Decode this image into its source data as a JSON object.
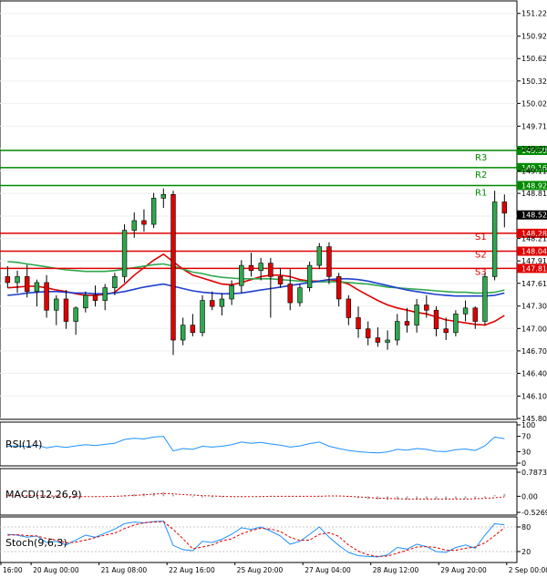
{
  "chart_data": {
    "type": "candlestick",
    "main": {
      "y_ticks": [
        "151.225",
        "150.920",
        "150.620",
        "150.320",
        "150.020",
        "149.715",
        "149.415",
        "149.115",
        "148.815",
        "148.510",
        "148.210",
        "147.910",
        "147.610",
        "147.305",
        "147.005",
        "146.705",
        "146.405",
        "146.100",
        "145.800"
      ],
      "ylim": [
        145.8,
        151.38
      ],
      "current_price": 148.526,
      "current_price_label": "148.526",
      "resistance": [
        {
          "name": "R3",
          "value": 149.39,
          "label": "149.390"
        },
        {
          "name": "R2",
          "value": 149.16,
          "label": "149.160"
        },
        {
          "name": "R1",
          "value": 148.92,
          "label": "148.920"
        }
      ],
      "support": [
        {
          "name": "S1",
          "value": 148.28,
          "label": "148.280"
        },
        {
          "name": "S2",
          "value": 148.04,
          "label": "148.040"
        },
        {
          "name": "S3",
          "value": 147.81,
          "label": "147.810"
        }
      ],
      "candles": [
        [
          147.7,
          147.84,
          147.55,
          147.62
        ],
        [
          147.62,
          147.78,
          147.48,
          147.7
        ],
        [
          147.7,
          147.86,
          147.42,
          147.5
        ],
        [
          147.5,
          147.66,
          147.3,
          147.62
        ],
        [
          147.62,
          147.72,
          147.15,
          147.25
        ],
        [
          147.25,
          147.45,
          147.05,
          147.4
        ],
        [
          147.4,
          147.52,
          147.0,
          147.1
        ],
        [
          147.1,
          147.3,
          146.92,
          147.28
        ],
        [
          147.28,
          147.5,
          147.22,
          147.45
        ],
        [
          147.45,
          147.58,
          147.3,
          147.38
        ],
        [
          147.38,
          147.6,
          147.25,
          147.55
        ],
        [
          147.55,
          147.75,
          147.45,
          147.7
        ],
        [
          147.7,
          148.4,
          147.62,
          148.32
        ],
        [
          148.32,
          148.56,
          148.22,
          148.45
        ],
        [
          148.45,
          148.6,
          148.3,
          148.4
        ],
        [
          148.4,
          148.82,
          148.35,
          148.75
        ],
        [
          148.75,
          148.88,
          148.62,
          148.8
        ],
        [
          148.8,
          148.85,
          146.65,
          146.85
        ],
        [
          146.85,
          147.15,
          146.78,
          147.05
        ],
        [
          147.05,
          147.2,
          146.9,
          146.95
        ],
        [
          146.95,
          147.45,
          146.9,
          147.38
        ],
        [
          147.38,
          147.5,
          147.25,
          147.3
        ],
        [
          147.3,
          147.48,
          147.18,
          147.4
        ],
        [
          147.4,
          147.65,
          147.32,
          147.58
        ],
        [
          147.58,
          147.92,
          147.48,
          147.85
        ],
        [
          147.85,
          148.02,
          147.7,
          147.78
        ],
        [
          147.78,
          147.95,
          147.65,
          147.88
        ],
        [
          147.88,
          147.95,
          147.15,
          147.7
        ],
        [
          147.7,
          147.82,
          147.55,
          147.6
        ],
        [
          147.6,
          147.8,
          147.25,
          147.35
        ],
        [
          147.35,
          147.6,
          147.3,
          147.55
        ],
        [
          147.55,
          147.9,
          147.5,
          147.85
        ],
        [
          147.85,
          148.15,
          147.8,
          148.1
        ],
        [
          148.1,
          148.16,
          147.6,
          147.7
        ],
        [
          147.7,
          147.75,
          147.3,
          147.4
        ],
        [
          147.4,
          147.45,
          147.05,
          147.15
        ],
        [
          147.15,
          147.3,
          146.88,
          147.0
        ],
        [
          147.0,
          147.1,
          146.78,
          146.88
        ],
        [
          146.88,
          147.02,
          146.76,
          146.82
        ],
        [
          146.82,
          146.98,
          146.72,
          146.85
        ],
        [
          146.85,
          147.2,
          146.78,
          147.1
        ],
        [
          147.1,
          147.28,
          146.95,
          147.05
        ],
        [
          147.05,
          147.4,
          146.95,
          147.32
        ],
        [
          147.32,
          147.45,
          147.15,
          147.25
        ],
        [
          147.25,
          147.3,
          146.9,
          147.0
        ],
        [
          147.0,
          147.15,
          146.85,
          146.95
        ],
        [
          146.95,
          147.25,
          146.9,
          147.2
        ],
        [
          147.2,
          147.38,
          147.1,
          147.28
        ],
        [
          147.28,
          147.3,
          147.0,
          147.1
        ],
        [
          147.1,
          147.75,
          147.05,
          147.7
        ],
        [
          147.7,
          148.85,
          147.65,
          148.7
        ],
        [
          148.7,
          148.8,
          148.36,
          148.55
        ]
      ],
      "moving_averages": [
        {
          "color": "#e00000",
          "values": [
            147.55,
            147.56,
            147.57,
            147.57,
            147.55,
            147.52,
            147.5,
            147.47,
            147.45,
            147.45,
            147.46,
            147.49,
            147.6,
            147.72,
            147.82,
            147.92,
            148.0,
            147.9,
            147.8,
            147.72,
            147.68,
            147.64,
            147.6,
            147.59,
            147.62,
            147.66,
            147.7,
            147.72,
            147.72,
            147.7,
            147.66,
            147.64,
            147.64,
            147.66,
            147.64,
            147.6,
            147.52,
            147.45,
            147.38,
            147.32,
            147.28,
            147.25,
            147.22,
            147.2,
            147.16,
            147.12,
            147.1,
            147.08,
            147.06,
            147.05,
            147.1,
            147.18
          ]
        },
        {
          "color": "#2fa84f",
          "values": [
            147.9,
            147.89,
            147.87,
            147.85,
            147.83,
            147.81,
            147.79,
            147.78,
            147.77,
            147.77,
            147.77,
            147.78,
            147.8,
            147.82,
            147.84,
            147.86,
            147.87,
            147.84,
            147.8,
            147.76,
            147.74,
            147.71,
            147.69,
            147.68,
            147.67,
            147.67,
            147.67,
            147.67,
            147.66,
            147.65,
            147.64,
            147.63,
            147.63,
            147.63,
            147.63,
            147.62,
            147.61,
            147.6,
            147.58,
            147.56,
            147.55,
            147.54,
            147.53,
            147.52,
            147.51,
            147.5,
            147.49,
            147.49,
            147.48,
            147.48,
            147.49,
            147.52
          ]
        },
        {
          "color": "#2040d0",
          "values": [
            147.45,
            147.46,
            147.48,
            147.49,
            147.5,
            147.5,
            147.49,
            147.48,
            147.48,
            147.47,
            147.47,
            147.48,
            147.5,
            147.53,
            147.56,
            147.58,
            147.6,
            147.57,
            147.54,
            147.51,
            147.49,
            147.48,
            147.47,
            147.47,
            147.48,
            147.5,
            147.52,
            147.54,
            147.56,
            147.58,
            147.6,
            147.62,
            147.64,
            147.66,
            147.67,
            147.67,
            147.66,
            147.64,
            147.61,
            147.58,
            147.55,
            147.52,
            147.5,
            147.48,
            147.46,
            147.45,
            147.44,
            147.44,
            147.44,
            147.44,
            147.45,
            147.48
          ]
        }
      ]
    },
    "rsi": {
      "label": "RSI(14)",
      "y_ticks": [
        "100",
        "70",
        "30",
        "0"
      ],
      "ylim": [
        0,
        100
      ],
      "values": [
        44,
        45,
        43,
        47,
        40,
        44,
        41,
        45,
        48,
        46,
        49,
        52,
        62,
        65,
        63,
        68,
        70,
        32,
        38,
        36,
        44,
        42,
        44,
        48,
        55,
        52,
        54,
        50,
        47,
        42,
        45,
        51,
        55,
        44,
        38,
        33,
        30,
        28,
        27,
        29,
        36,
        34,
        38,
        36,
        31,
        30,
        35,
        37,
        33,
        45,
        68,
        64
      ]
    },
    "macd": {
      "label": "MACD(12,26,9)",
      "y_ticks": [
        "0.7873",
        "0.00",
        "-0.5269"
      ],
      "ylim": [
        -0.5269,
        0.7873
      ],
      "histogram": [
        0.03,
        0.03,
        0.02,
        0.02,
        0.01,
        0.0,
        -0.01,
        -0.02,
        -0.02,
        -0.02,
        -0.01,
        0.0,
        0.04,
        0.07,
        0.09,
        0.11,
        0.13,
        0.05,
        0.0,
        -0.03,
        -0.04,
        -0.04,
        -0.04,
        -0.03,
        -0.02,
        0.0,
        0.01,
        0.01,
        0.0,
        -0.01,
        -0.01,
        0.0,
        0.02,
        0.02,
        0.0,
        -0.03,
        -0.06,
        -0.09,
        -0.11,
        -0.12,
        -0.11,
        -0.11,
        -0.1,
        -0.09,
        -0.1,
        -0.1,
        -0.09,
        -0.08,
        -0.08,
        -0.05,
        0.04,
        0.08
      ],
      "signal": [
        0.02,
        0.02,
        0.02,
        0.02,
        0.01,
        0.01,
        0.0,
        -0.01,
        -0.01,
        -0.01,
        -0.01,
        0.0,
        0.01,
        0.03,
        0.05,
        0.07,
        0.09,
        0.08,
        0.06,
        0.04,
        0.02,
        0.01,
        0.0,
        -0.01,
        -0.01,
        -0.01,
        -0.01,
        0.0,
        0.0,
        0.0,
        0.0,
        0.0,
        0.0,
        0.01,
        0.01,
        0.0,
        -0.02,
        -0.04,
        -0.06,
        -0.07,
        -0.08,
        -0.09,
        -0.09,
        -0.09,
        -0.09,
        -0.09,
        -0.09,
        -0.09,
        -0.08,
        -0.07,
        -0.05,
        -0.02
      ]
    },
    "stoch": {
      "label": "Stoch(9,6,3)",
      "y_ticks": [
        "80",
        "20"
      ],
      "ylim": [
        0,
        100
      ],
      "k": [
        62,
        60,
        55,
        58,
        42,
        45,
        36,
        48,
        60,
        55,
        65,
        75,
        88,
        92,
        90,
        93,
        94,
        35,
        25,
        22,
        45,
        42,
        50,
        62,
        78,
        74,
        80,
        70,
        58,
        38,
        45,
        62,
        80,
        55,
        35,
        18,
        10,
        8,
        7,
        12,
        30,
        26,
        38,
        32,
        20,
        18,
        30,
        36,
        28,
        60,
        88,
        85
      ],
      "d": [
        60,
        61,
        59,
        58,
        52,
        48,
        41,
        43,
        48,
        54,
        60,
        65,
        76,
        85,
        90,
        92,
        93,
        74,
        51,
        27,
        31,
        36,
        46,
        51,
        63,
        71,
        77,
        75,
        69,
        55,
        47,
        48,
        62,
        66,
        57,
        36,
        21,
        12,
        8,
        9,
        16,
        23,
        31,
        32,
        30,
        23,
        23,
        28,
        31,
        41,
        59,
        78
      ]
    },
    "x_labels": [
      {
        "i": 0,
        "label": "16:00"
      },
      {
        "i": 4,
        "label": "20 Aug 00:00"
      },
      {
        "i": 13,
        "label": "21 Aug 08:00"
      },
      {
        "i": 22,
        "label": "22 Aug 16:00"
      },
      {
        "i": 31,
        "label": "25 Aug 20:00"
      },
      {
        "i": 40,
        "label": "27 Aug 04:00"
      },
      {
        "i": 49,
        "label": "28 Aug 12:00"
      },
      {
        "i": 58,
        "label": "29 Aug 20:00"
      },
      {
        "i": 67,
        "label": "2 Sep 00:00"
      }
    ],
    "x_label_positions": [
      0,
      4,
      13,
      22,
      31,
      40,
      49,
      58,
      67
    ]
  }
}
